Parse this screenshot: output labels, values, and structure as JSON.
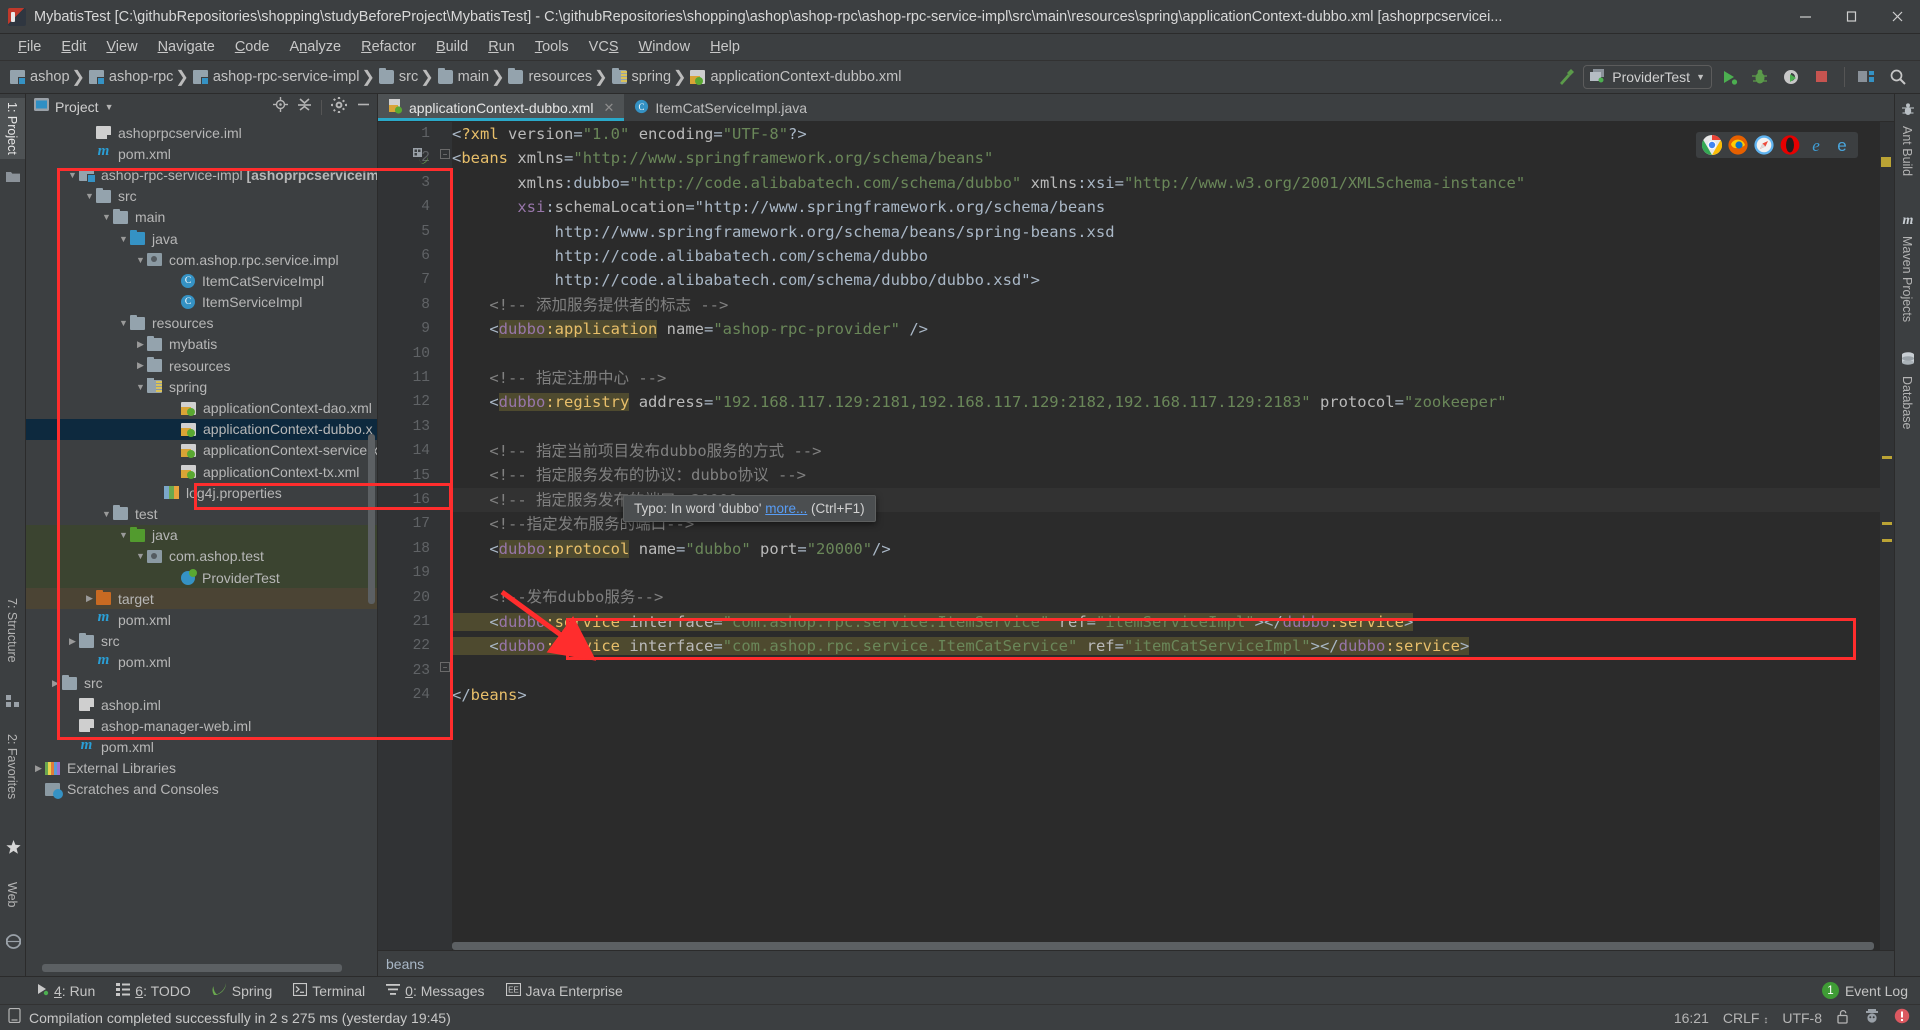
{
  "window": {
    "title": "MybatisTest [C:\\githubRepositories\\shopping\\studyBeforeProject\\MybatisTest] - C:\\githubRepositories\\shopping\\ashop\\ashop-rpc\\ashop-rpc-service-impl\\src\\main\\resources\\spring\\applicationContext-dubbo.xml [ashoprpcservicei...",
    "minimize": "−",
    "maximize": "❐",
    "close": "✕"
  },
  "menu": [
    "File",
    "Edit",
    "View",
    "Navigate",
    "Code",
    "Analyze",
    "Refactor",
    "Build",
    "Run",
    "Tools",
    "VCS",
    "Window",
    "Help"
  ],
  "navbar": {
    "crumbs": [
      {
        "label": "ashop",
        "icon": "module-icon"
      },
      {
        "label": "ashop-rpc",
        "icon": "module-icon"
      },
      {
        "label": "ashop-rpc-service-impl",
        "icon": "module-icon"
      },
      {
        "label": "src",
        "icon": "folder-icon"
      },
      {
        "label": "main",
        "icon": "folder-icon"
      },
      {
        "label": "resources",
        "icon": "folder-icon"
      },
      {
        "label": "spring",
        "icon": "spring-folder-icon"
      },
      {
        "label": "applicationContext-dubbo.xml",
        "icon": "xml-file-icon"
      }
    ],
    "run_configuration": "ProviderTest",
    "buttons": [
      "run-button",
      "debug-button",
      "run-coverage-button",
      "stop-button",
      "project-structure-button",
      "search-everywhere-button"
    ]
  },
  "project_panel": {
    "title": "Project",
    "header_actions": [
      "locate-icon",
      "collapse-all-icon",
      "settings-gear-icon",
      "hide-icon"
    ],
    "tree": [
      {
        "label": "ashoprpcservice.iml",
        "indent": 3,
        "arrow": "",
        "icon": "iml"
      },
      {
        "label": "pom.xml",
        "indent": 3,
        "arrow": "",
        "icon": "mvn"
      },
      {
        "label": "ashop-rpc-service-impl [ashoprpcserviceim",
        "indent": 2,
        "arrow": "▼",
        "icon": "mod",
        "bold_tail": true
      },
      {
        "label": "src",
        "indent": 3,
        "arrow": "▼",
        "icon": "fold"
      },
      {
        "label": "main",
        "indent": 4,
        "arrow": "▼",
        "icon": "fold"
      },
      {
        "label": "java",
        "indent": 5,
        "arrow": "▼",
        "icon": "fold blue"
      },
      {
        "label": "com.ashop.rpc.service.impl",
        "indent": 6,
        "arrow": "▼",
        "icon": "pkg"
      },
      {
        "label": "ItemCatServiceImpl",
        "indent": 8,
        "arrow": "",
        "icon": "cls"
      },
      {
        "label": "ItemServiceImpl",
        "indent": 8,
        "arrow": "",
        "icon": "cls"
      },
      {
        "label": "resources",
        "indent": 5,
        "arrow": "▼",
        "icon": "fold"
      },
      {
        "label": "mybatis",
        "indent": 6,
        "arrow": "▶",
        "icon": "fold"
      },
      {
        "label": "resources",
        "indent": 6,
        "arrow": "▶",
        "icon": "fold"
      },
      {
        "label": "spring",
        "indent": 6,
        "arrow": "▼",
        "icon": "springfold"
      },
      {
        "label": "applicationContext-dao.xml",
        "indent": 8,
        "arrow": "",
        "icon": "xml"
      },
      {
        "label": "applicationContext-dubbo.x",
        "indent": 8,
        "arrow": "",
        "icon": "xml",
        "state": "selected"
      },
      {
        "label": "applicationContext-service.x",
        "indent": 8,
        "arrow": "",
        "icon": "xml"
      },
      {
        "label": "applicationContext-tx.xml",
        "indent": 8,
        "arrow": "",
        "icon": "xml"
      },
      {
        "label": "log4j.properties",
        "indent": 7,
        "arrow": "",
        "icon": "props"
      },
      {
        "label": "test",
        "indent": 4,
        "arrow": "▼",
        "icon": "fold"
      },
      {
        "label": "java",
        "indent": 5,
        "arrow": "▼",
        "icon": "fold green",
        "state": "green"
      },
      {
        "label": "com.ashop.test",
        "indent": 6,
        "arrow": "▼",
        "icon": "pkg",
        "state": "green"
      },
      {
        "label": "ProviderTest",
        "indent": 8,
        "arrow": "",
        "icon": "test",
        "state": "green"
      },
      {
        "label": "target",
        "indent": 3,
        "arrow": "▶",
        "icon": "fold orange",
        "state": "brown"
      },
      {
        "label": "pom.xml",
        "indent": 3,
        "arrow": "",
        "icon": "mvn"
      },
      {
        "label": "src",
        "indent": 2,
        "arrow": "▶",
        "icon": "fold"
      },
      {
        "label": "pom.xml",
        "indent": 3,
        "arrow": "",
        "icon": "mvn"
      },
      {
        "label": "src",
        "indent": 1,
        "arrow": "▶",
        "icon": "fold"
      },
      {
        "label": "ashop.iml",
        "indent": 2,
        "arrow": "",
        "icon": "iml"
      },
      {
        "label": "ashop-manager-web.iml",
        "indent": 2,
        "arrow": "",
        "icon": "iml"
      },
      {
        "label": "pom.xml",
        "indent": 2,
        "arrow": "",
        "icon": "mvn"
      },
      {
        "label": "External Libraries",
        "indent": 0,
        "arrow": "▶",
        "icon": "lib"
      },
      {
        "label": "Scratches and Consoles",
        "indent": 0,
        "arrow": "",
        "icon": "scratch"
      }
    ]
  },
  "left_tool_window_tabs": [
    "1: Project",
    "7: Structure",
    "2: Favorites",
    "Web"
  ],
  "right_tool_window_tabs": [
    "Ant Build",
    "Maven Projects",
    "Database"
  ],
  "editor": {
    "tabs": [
      {
        "label": "applicationContext-dubbo.xml",
        "icon": "xml-file-icon",
        "active": true,
        "closable": true
      },
      {
        "label": "ItemCatServiceImpl.java",
        "icon": "class-icon",
        "active": false,
        "closable": false
      }
    ],
    "line_numbers": [
      1,
      2,
      3,
      4,
      5,
      6,
      7,
      8,
      9,
      10,
      11,
      12,
      13,
      14,
      15,
      16,
      17,
      18,
      19,
      20,
      21,
      22,
      23,
      24
    ],
    "lines": [
      "<?xml version=\"1.0\" encoding=\"UTF-8\"?>",
      "<beans xmlns=\"http://www.springframework.org/schema/beans\"",
      "       xmlns:dubbo=\"http://code.alibabatech.com/schema/dubbo\" xmlns:xsi=\"http://www.w3.org/2001/XMLSchema-instance\"",
      "       xsi:schemaLocation=\"http://www.springframework.org/schema/beans",
      "           http://www.springframework.org/schema/beans/spring-beans.xsd",
      "           http://code.alibabatech.com/schema/dubbo",
      "           http://code.alibabatech.com/schema/dubbo/dubbo.xsd\">",
      "    <!-- 添加服务提供者的标志 -->",
      "    <dubbo:application name=\"ashop-rpc-provider\" />",
      "",
      "    <!-- 指定注册中心 -->",
      "    <dubbo:registry address=\"192.168.117.129:2181,192.168.117.129:2182,192.168.117.129:2183\" protocol=\"zookeeper\"",
      "",
      "    <!-- 指定当前项目发布dubbo服务的方式 -->",
      "    <!-- 指定服务发布的协议：dubbo协议 -->",
      "    <!-- 指定服务发布的端口：20000 -->",
      "    <!--指定发布服务的端口-->",
      "    <dubbo:protocol name=\"dubbo\" port=\"20000\"/>",
      "",
      "    <!--发布dubbo服务-->",
      "    <dubbo:service interface=\"com.ashop.rpc.service.ItemService\" ref=\"itemServiceImpl\"></dubbo:service>",
      "    <dubbo:service interface=\"com.ashop.rpc.service.ItemCatService\" ref=\"itemCatServiceImpl\"></dubbo:service>",
      "",
      "</beans>"
    ],
    "tooltip": {
      "prefix": "Typo: In word 'dubbo' ",
      "link": "more...",
      "suffix": " (Ctrl+F1)"
    },
    "browser_icons": [
      "chrome-icon",
      "firefox-icon",
      "safari-icon",
      "opera-icon",
      "ie-icon",
      "edge-icon"
    ],
    "breadcrumb": "beans"
  },
  "bottom_bar": {
    "items": [
      {
        "label": "4: Run",
        "underline": "4",
        "icon": "run-icon"
      },
      {
        "label": "6: TODO",
        "underline": "6",
        "icon": "todo-icon"
      },
      {
        "label": "Spring",
        "underline": "",
        "icon": "spring-leaf-icon"
      },
      {
        "label": "Terminal",
        "underline": "",
        "icon": "terminal-icon"
      },
      {
        "label": "0: Messages",
        "underline": "0",
        "icon": "messages-icon"
      },
      {
        "label": "Java Enterprise",
        "underline": "",
        "icon": "java-ee-icon"
      }
    ],
    "event_log": {
      "label": "Event Log",
      "count": "1"
    }
  },
  "status_bar": {
    "message": "Compilation completed successfully in 2 s 275 ms (yesterday 19:45)",
    "time": "16:21",
    "line_separator": "CRLF",
    "encoding": "UTF-8",
    "lock_icon": "unlocked-icon",
    "inspection_icon": "inspector-icon",
    "error_icon": "error-badge-icon"
  },
  "colors": {
    "accent": "#2aa9c9",
    "annotation_red": "#ff2d2d",
    "selection_blue": "#0d293e",
    "string_green": "#6a8759",
    "tag_yellow": "#e8bf6a",
    "ns_purple": "#9876aa",
    "comment_grey": "#808080",
    "highlight_olive": "#4e4a2f"
  }
}
